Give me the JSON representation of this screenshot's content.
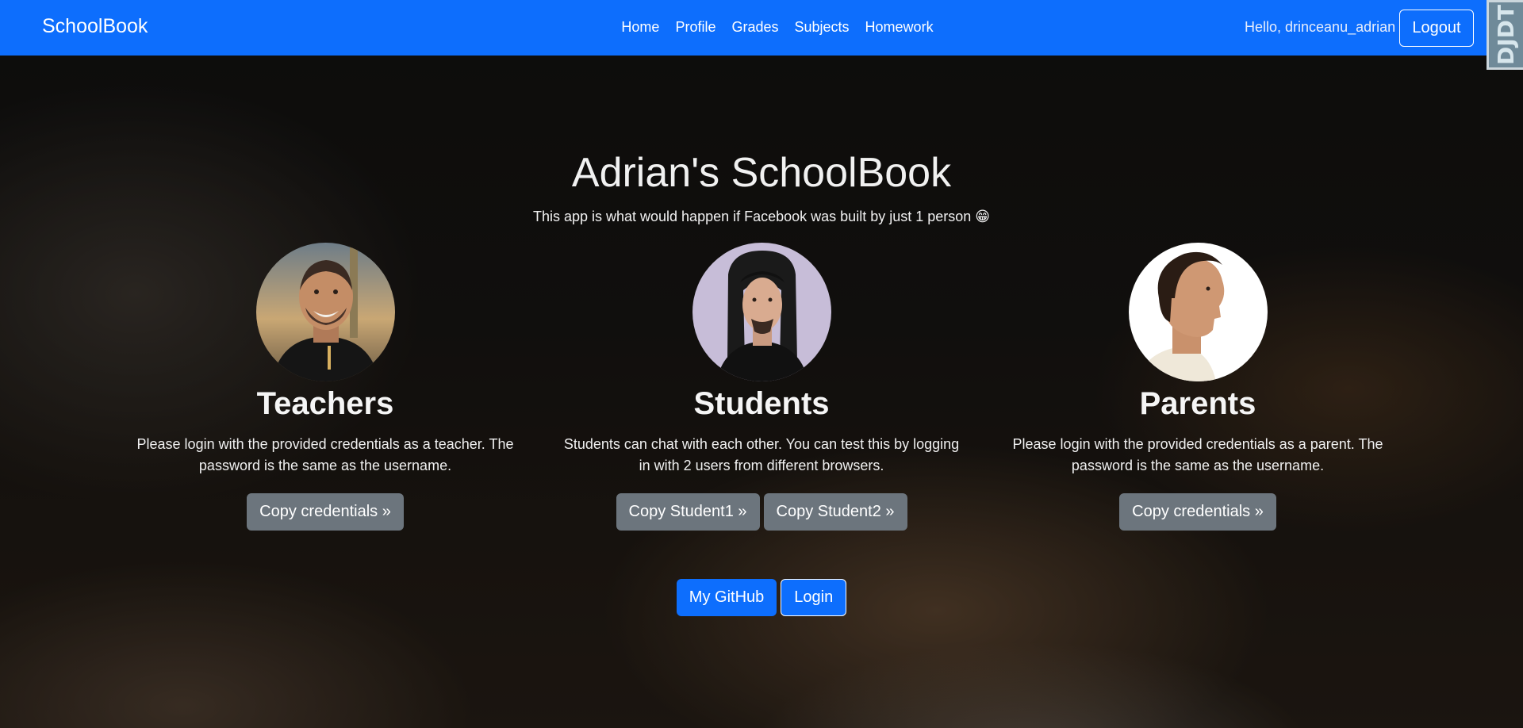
{
  "navbar": {
    "brand": "SchoolBook",
    "links": [
      "Home",
      "Profile",
      "Grades",
      "Subjects",
      "Homework"
    ],
    "greeting": "Hello, drinceanu_adrian",
    "logout_label": "Logout",
    "debug_toolbar_label": "DJDT"
  },
  "hero": {
    "title": "Adrian's SchoolBook",
    "subtitle": "This app is what would happen if Facebook was built by just 1 person 😁"
  },
  "columns": [
    {
      "title": "Teachers",
      "text": "Please login with the provided credentials as a teacher. The password is the same as the username.",
      "buttons": [
        "Copy credentials »"
      ]
    },
    {
      "title": "Students",
      "text": "Students can chat with each other. You can test this by logging in with 2 users from different browsers.",
      "buttons": [
        "Copy Student1 »",
        "Copy Student2 »"
      ]
    },
    {
      "title": "Parents",
      "text": "Please login with the provided credentials as a parent. The password is the same as the username.",
      "buttons": [
        "Copy credentials »"
      ]
    }
  ],
  "bottom": {
    "github_label": "My GitHub",
    "login_label": "Login"
  },
  "colors": {
    "navbar": "#0d6efd",
    "button_gray": "#6c757d",
    "button_blue": "#0d6efd"
  }
}
